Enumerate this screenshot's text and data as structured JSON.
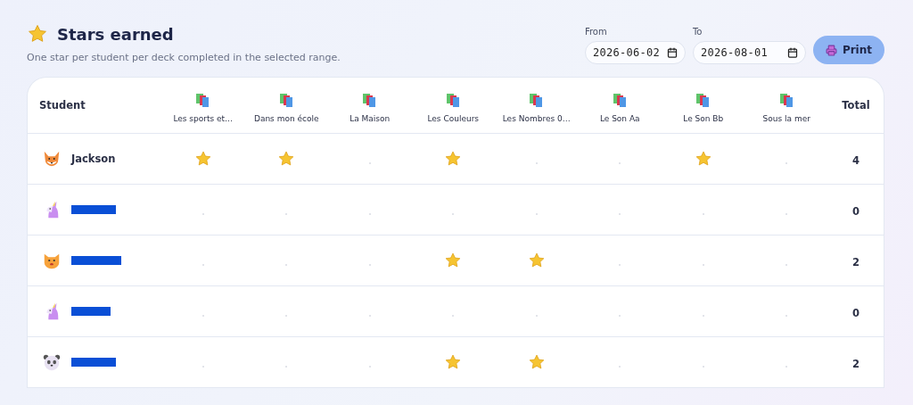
{
  "header": {
    "title": "Stars earned",
    "subtitle": "One star per student per deck completed in the selected range."
  },
  "filters": {
    "from": {
      "label": "From",
      "value": "2026-06-02"
    },
    "to": {
      "label": "To",
      "value": "2026-08-01"
    },
    "print_button": "Print"
  },
  "table": {
    "student_column": "Student",
    "total_column": "Total",
    "decks": [
      "Les sports et…",
      "Dans mon école",
      "La Maison",
      "Les Couleurs",
      "Les Nombres 0…",
      "Le Son Aa",
      "Le Son Bb",
      "Sous la mer"
    ],
    "rows": [
      {
        "kind": "fox",
        "name": "Jackson",
        "redacted": false,
        "earned": [
          true,
          true,
          false,
          true,
          false,
          false,
          true,
          false
        ],
        "total": "4"
      },
      {
        "kind": "unicorn",
        "redacted": true,
        "earned": [
          false,
          false,
          false,
          false,
          false,
          false,
          false,
          false
        ],
        "total": "0"
      },
      {
        "kind": "cat",
        "redacted": true,
        "earned": [
          false,
          false,
          false,
          true,
          true,
          false,
          false,
          false
        ],
        "total": "2"
      },
      {
        "kind": "unicorn",
        "redacted": true,
        "earned": [
          false,
          false,
          false,
          false,
          false,
          false,
          false,
          false
        ],
        "total": "0"
      },
      {
        "kind": "panda",
        "redacted": true,
        "earned": [
          false,
          false,
          false,
          true,
          true,
          false,
          false,
          false
        ],
        "total": "2"
      }
    ]
  }
}
